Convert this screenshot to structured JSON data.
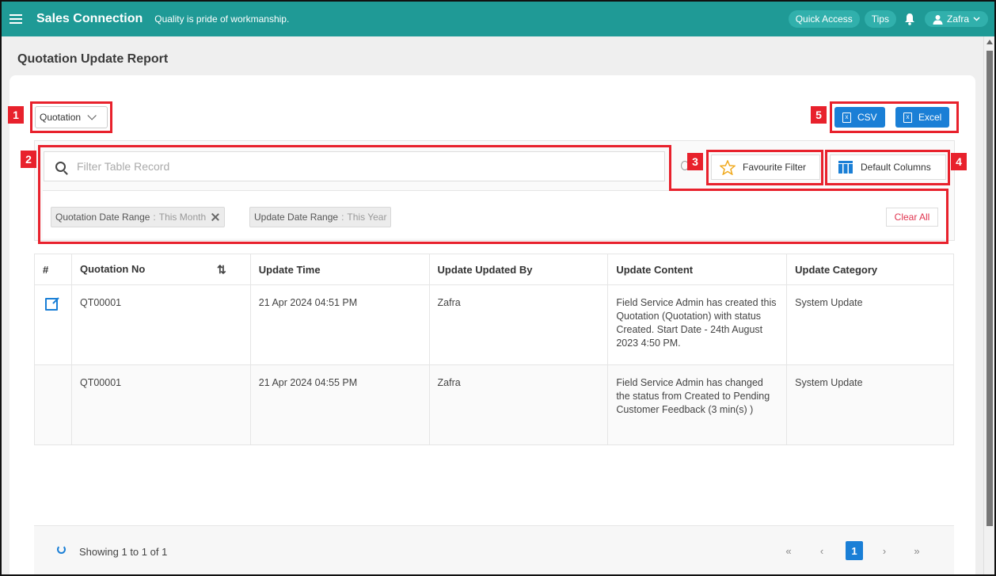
{
  "header": {
    "brand": "Sales Connection",
    "tagline": "Quality is pride of workmanship.",
    "quick_access": "Quick Access",
    "tips": "Tips",
    "user_name": "Zafra",
    "color": "#1f9a96"
  },
  "page": {
    "title": "Quotation Update Report"
  },
  "module_select": {
    "value": "Quotation"
  },
  "export": {
    "csv": "CSV",
    "excel": "Excel",
    "color": "#1a7fd6"
  },
  "filter": {
    "placeholder": "Filter Table Record",
    "favourite": "Favourite Filter",
    "default_columns": "Default Columns",
    "chips": [
      {
        "label": "Quotation Date Range",
        "sep": ":",
        "value": "This Month"
      },
      {
        "label": "Update Date Range",
        "sep": ":",
        "value": "This Year"
      }
    ],
    "clear_all": "Clear All"
  },
  "annotations": [
    "1",
    "2",
    "3",
    "4",
    "5"
  ],
  "table": {
    "columns": [
      "#",
      "Quotation No",
      "Update Time",
      "Update Updated By",
      "Update Content",
      "Update Category"
    ],
    "rows": [
      {
        "quotation_no": "QT00001",
        "update_time": "21 Apr 2024 04:51 PM",
        "updated_by": "Zafra",
        "content": "Field Service Admin has created this Quotation (Quotation) with status Created. Start Date - 24th August 2023 4:50 PM.",
        "category": "System Update"
      },
      {
        "quotation_no": "QT00001",
        "update_time": "21 Apr 2024 04:55 PM",
        "updated_by": "Zafra",
        "content": "Field Service Admin has changed the status from Created to Pending Customer Feedback (3 min(s) )",
        "category": "System Update"
      }
    ]
  },
  "footer": {
    "showing": "Showing 1 to 1 of 1",
    "pagination": {
      "first": "«",
      "prev": "‹",
      "current": "1",
      "next": "›",
      "last": "»"
    }
  }
}
